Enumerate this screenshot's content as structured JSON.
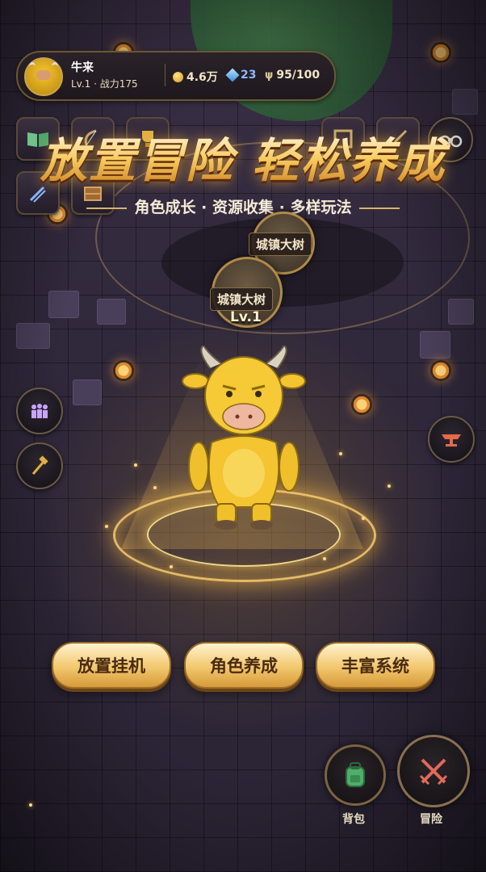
{
  "player": {
    "name": "牛来",
    "level_text": "Lv.1 · 战力175",
    "gold": "4.6万",
    "gems": "23",
    "stamina": "95/100"
  },
  "headline": {
    "title": "放置冒险 轻松养成",
    "subtitle": "角色成长 · 资源收集 · 多样玩法"
  },
  "buildings": [
    {
      "label": "城镇大树"
    },
    {
      "label": "城镇大树",
      "level": "Lv.1"
    }
  ],
  "features": [
    {
      "label": "放置挂机"
    },
    {
      "label": "角色养成"
    },
    {
      "label": "丰富系统"
    }
  ],
  "actions": {
    "bag_label": "背包",
    "adventure_label": "冒险"
  },
  "icons": {
    "top_left": [
      "book-icon",
      "bow-icon",
      "trophy-icon",
      "frame-icon",
      "sword-icon"
    ],
    "top_right": [
      "binoculars-icon"
    ],
    "left_side": [
      "crowd-icon",
      "hammer-icon"
    ],
    "right_side": [
      "anvil-icon"
    ]
  },
  "colors": {
    "accent_gold": "#f2c76d",
    "gem_blue": "#3c8bd9",
    "bag_green": "#4fae6a",
    "adventure_red": "#e06a5a"
  }
}
